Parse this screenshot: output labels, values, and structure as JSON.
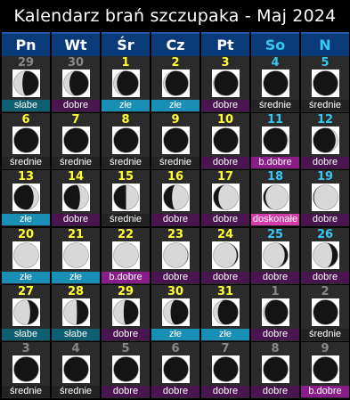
{
  "title": "Kalendarz brań szczupaka - Maj 2024",
  "colors": {
    "weekday": "#ffffff",
    "weekend": "#35c8f0",
    "day_current": "#ffff33",
    "day_weekend_current": "#35c8f0",
    "day_other": "#888888",
    "rating_bg": {
      "słabe": "#0f5f73",
      "złe": "#1a8fb5",
      "dobre": "#4a1450",
      "średnie": "#222222",
      "b.dobre": "#8a1d8a",
      "doskonałe": "#d63aa8"
    }
  },
  "weekdays": [
    {
      "label": "Pn",
      "weekend": false
    },
    {
      "label": "Wt",
      "weekend": false
    },
    {
      "label": "Śr",
      "weekend": false
    },
    {
      "label": "Cz",
      "weekend": false
    },
    {
      "label": "Pt",
      "weekend": false
    },
    {
      "label": "So",
      "weekend": true
    },
    {
      "label": "N",
      "weekend": true
    }
  ],
  "weeks": [
    [
      {
        "day": "29",
        "rating": "słabe",
        "current": false,
        "phase": 0.8
      },
      {
        "day": "30",
        "rating": "dobre",
        "current": false,
        "phase": 0.84
      },
      {
        "day": "1",
        "rating": "złe",
        "current": true,
        "phase": 0.88
      },
      {
        "day": "2",
        "rating": "złe",
        "current": true,
        "phase": 0.91
      },
      {
        "day": "3",
        "rating": "dobre",
        "current": true,
        "phase": 0.94
      },
      {
        "day": "4",
        "rating": "średnie",
        "current": true,
        "phase": 0.96
      },
      {
        "day": "5",
        "rating": "średnie",
        "current": true,
        "phase": 0.98
      }
    ],
    [
      {
        "day": "6",
        "rating": "średnie",
        "current": true,
        "phase": 0.995
      },
      {
        "day": "7",
        "rating": "średnie",
        "current": true,
        "phase": 0.0
      },
      {
        "day": "8",
        "rating": "średnie",
        "current": true,
        "phase": 0.0
      },
      {
        "day": "9",
        "rating": "średnie",
        "current": true,
        "phase": 0.01
      },
      {
        "day": "10",
        "rating": "dobre",
        "current": true,
        "phase": 0.03
      },
      {
        "day": "11",
        "rating": "b.dobre",
        "current": true,
        "phase": 0.06
      },
      {
        "day": "12",
        "rating": "dobre",
        "current": true,
        "phase": 0.1
      }
    ],
    [
      {
        "day": "13",
        "rating": "złe",
        "current": true,
        "phase": 0.15
      },
      {
        "day": "14",
        "rating": "dobre",
        "current": true,
        "phase": 0.2
      },
      {
        "day": "15",
        "rating": "średnie",
        "current": true,
        "phase": 0.25
      },
      {
        "day": "16",
        "rating": "dobre",
        "current": true,
        "phase": 0.3
      },
      {
        "day": "17",
        "rating": "dobre",
        "current": true,
        "phase": 0.35
      },
      {
        "day": "18",
        "rating": "doskonałe",
        "current": true,
        "phase": 0.4
      },
      {
        "day": "19",
        "rating": "dobre",
        "current": true,
        "phase": 0.44
      }
    ],
    [
      {
        "day": "20",
        "rating": "złe",
        "current": true,
        "phase": 0.48
      },
      {
        "day": "21",
        "rating": "złe",
        "current": true,
        "phase": 0.5
      },
      {
        "day": "22",
        "rating": "b.dobre",
        "current": true,
        "phase": 0.52
      },
      {
        "day": "23",
        "rating": "dobre",
        "current": true,
        "phase": 0.55
      },
      {
        "day": "24",
        "rating": "dobre",
        "current": true,
        "phase": 0.58
      },
      {
        "day": "25",
        "rating": "dobre",
        "current": true,
        "phase": 0.62
      },
      {
        "day": "26",
        "rating": "dobre",
        "current": true,
        "phase": 0.66
      }
    ],
    [
      {
        "day": "27",
        "rating": "słabe",
        "current": true,
        "phase": 0.7
      },
      {
        "day": "28",
        "rating": "słabe",
        "current": true,
        "phase": 0.74
      },
      {
        "day": "29",
        "rating": "dobre",
        "current": true,
        "phase": 0.78
      },
      {
        "day": "30",
        "rating": "złe",
        "current": true,
        "phase": 0.82
      },
      {
        "day": "31",
        "rating": "złe",
        "current": true,
        "phase": 0.86
      },
      {
        "day": "1",
        "rating": "dobre",
        "current": false,
        "phase": 0.92
      },
      {
        "day": "2",
        "rating": "średnie",
        "current": false,
        "phase": 0.96
      }
    ],
    [
      {
        "day": "3",
        "rating": "średnie",
        "current": false,
        "phase": 0.985
      },
      {
        "day": "4",
        "rating": "średnie",
        "current": false,
        "phase": 0.995
      },
      {
        "day": "5",
        "rating": "dobre",
        "current": false,
        "phase": 0.0
      },
      {
        "day": "6",
        "rating": "dobre",
        "current": false,
        "phase": 0.0
      },
      {
        "day": "7",
        "rating": "dobre",
        "current": false,
        "phase": 0.0
      },
      {
        "day": "8",
        "rating": "dobre",
        "current": false,
        "phase": 0.01
      },
      {
        "day": "9",
        "rating": "b.dobre",
        "current": false,
        "phase": 0.03
      }
    ]
  ]
}
